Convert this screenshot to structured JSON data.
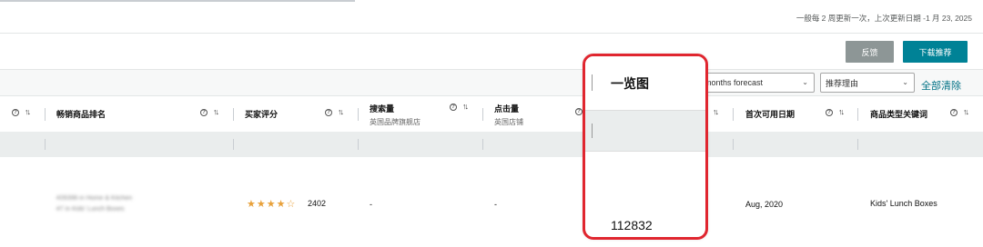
{
  "header": {
    "update_note": "一般每 2 周更新一次，上次更新日期 -1 月 23, 2025",
    "feedback_label": "反馈",
    "download_label": "下载推荐"
  },
  "filters": {
    "forecast_select": "months forecast",
    "reason_select": "推荐理由",
    "clear_all": "全部清除"
  },
  "columns": [
    {
      "label": "畅销商品排名",
      "sub": ""
    },
    {
      "label": "买家评分",
      "sub": ""
    },
    {
      "label": "搜索量",
      "sub": "英国品牌旗舰店"
    },
    {
      "label": "点击量",
      "sub": "英国店铺"
    },
    {
      "label": "首次可用日期",
      "sub": ""
    },
    {
      "label": "商品类型关键词",
      "sub": ""
    }
  ],
  "row": {
    "bsr_line1": "#26396 in Home & Kitchen",
    "bsr_line2": "#7 in Kids' Lunch Boxes",
    "stars": "★★★★☆",
    "rating": 4,
    "rating_count": "2402",
    "search_volume": "-",
    "clicks": "-",
    "first_available": "Aug, 2020",
    "keyword": "Kids' Lunch Boxes"
  },
  "overlay": {
    "title": "一览图",
    "value": "112832"
  },
  "colors": {
    "accent": "#008296",
    "link": "#007185",
    "highlight": "#e0262f",
    "star": "#e8a13b"
  }
}
